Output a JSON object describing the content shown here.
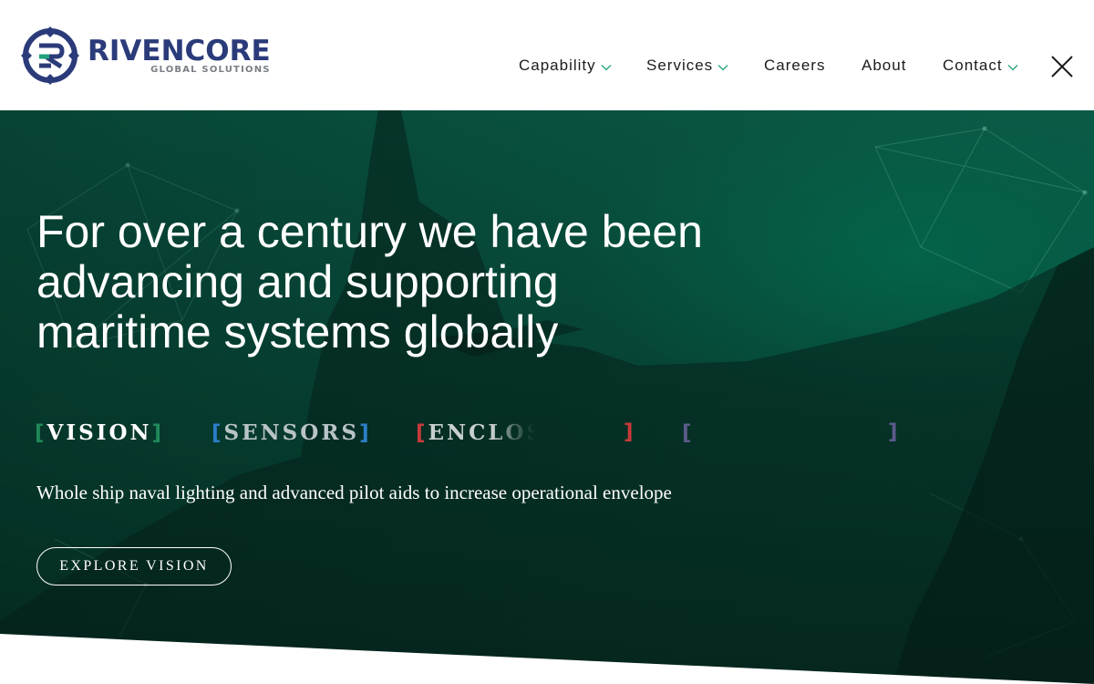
{
  "brand": {
    "name": "RIVENCORE",
    "tagline": "GLOBAL SOLUTIONS",
    "colors": {
      "primary": "#2b3b7a",
      "accent": "#1fa37a",
      "tagline": "#7a7f86"
    }
  },
  "nav": {
    "items": [
      {
        "label": "Capability",
        "has_dropdown": true
      },
      {
        "label": "Services",
        "has_dropdown": true
      },
      {
        "label": "Careers",
        "has_dropdown": false
      },
      {
        "label": "About",
        "has_dropdown": false
      },
      {
        "label": "Contact",
        "has_dropdown": true
      }
    ],
    "close_icon": "close-icon",
    "dropdown_icon": "chevron-down-icon",
    "dropdown_color": "#1fa37a"
  },
  "hero": {
    "headline": "For over a century we have been advancing and supporting maritime systems globally",
    "headline_lines": [
      "For over a century we have been",
      "advancing and supporting",
      "maritime systems globally"
    ],
    "rotating_words": [
      {
        "label": "VISION",
        "bracket_color": "#1f8a5a",
        "active": true
      },
      {
        "label": "SENSORS",
        "bracket_color": "#2b7ec9",
        "active": false
      },
      {
        "label": "ENCLOS",
        "bracket_color": "#c83a3a",
        "active": false
      },
      {
        "label": "",
        "bracket_color": "#5c5a8a",
        "active": false
      }
    ],
    "bracket_open": "[",
    "bracket_close": "]",
    "description": "Whole ship naval lighting and advanced pilot aids to increase operational envelope",
    "cta_label": "EXPLORE VISION",
    "background_color": "#074a3a"
  }
}
